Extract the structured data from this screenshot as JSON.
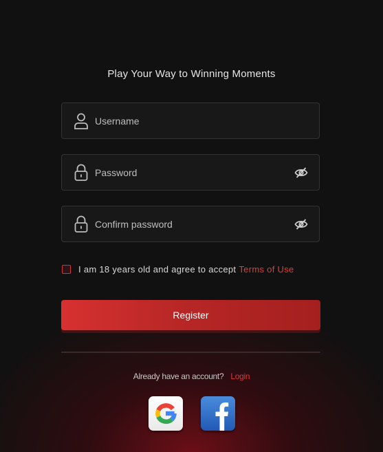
{
  "page": {
    "title": "Play Your Way to Winning Moments"
  },
  "form": {
    "username": {
      "placeholder": "Username",
      "value": "",
      "icon": "user-icon"
    },
    "password": {
      "placeholder": "Password",
      "value": "",
      "icon": "lock-icon",
      "toggle_icon": "eye-slash-icon"
    },
    "confirm_password": {
      "placeholder": "Confirm password",
      "value": "",
      "icon": "lock-icon",
      "toggle_icon": "eye-slash-icon"
    },
    "agree": {
      "checked": false,
      "text": "I am 18 years old and agree to accept",
      "link": "Terms of Use"
    },
    "register_label": "Register"
  },
  "login": {
    "prompt": "Already have an account?",
    "link": "Login"
  },
  "social": [
    {
      "name": "google-icon"
    },
    {
      "name": "facebook-icon"
    }
  ],
  "colors": {
    "background": "#111111",
    "accent": "#d73130",
    "link": "#e63a3a",
    "field_border": "#333333",
    "glow": "#7d0e18"
  }
}
